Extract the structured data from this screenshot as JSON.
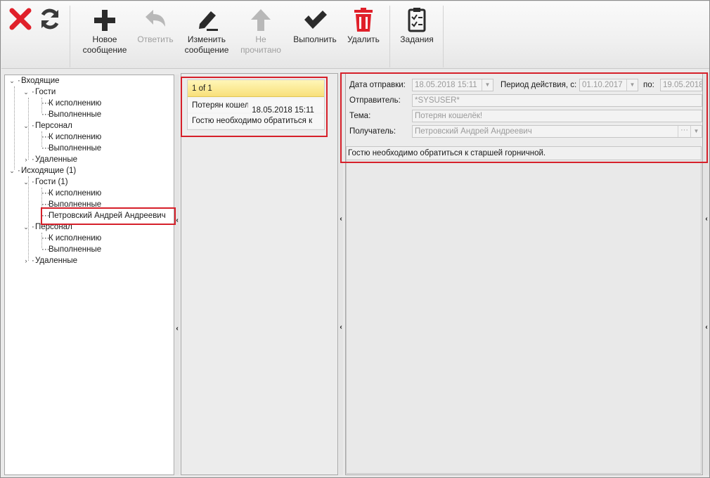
{
  "toolbar": {
    "close_icon": "close-x-icon",
    "refresh_icon": "refresh-icon",
    "buttons": [
      {
        "label1": "Новое",
        "label2": "сообщение",
        "icon": "plus-icon",
        "enabled": true
      },
      {
        "label1": "Ответить",
        "label2": "",
        "icon": "reply-icon",
        "enabled": false
      },
      {
        "label1": "Изменить",
        "label2": "сообщение",
        "icon": "pencil-icon",
        "enabled": true
      },
      {
        "label1": "Не",
        "label2": "прочитано",
        "icon": "arrow-up-icon",
        "enabled": false
      },
      {
        "label1": "Выполнить",
        "label2": "",
        "icon": "check-icon",
        "enabled": true
      },
      {
        "label1": "Удалить",
        "label2": "",
        "icon": "trash-icon",
        "enabled": true
      },
      {
        "label1": "Задания",
        "label2": "",
        "icon": "clipboard-icon",
        "enabled": true
      }
    ]
  },
  "tree": {
    "incoming": "Входящие",
    "incoming_guests": "Гости",
    "incoming_guests_todo": "К исполнению",
    "incoming_guests_done": "Выполненные",
    "incoming_staff": "Персонал",
    "incoming_staff_todo": "К исполнению",
    "incoming_staff_done": "Выполненные",
    "incoming_deleted": "Удаленные",
    "outgoing": "Исходящие (1)",
    "outgoing_guests": "Гости (1)",
    "outgoing_guests_todo": "К исполнению",
    "outgoing_guests_done": "Выполненные",
    "outgoing_guests_person": "Петровский Андрей Андреевич",
    "outgoing_staff": "Персонал",
    "outgoing_staff_todo": "К исполнению",
    "outgoing_staff_done": "Выполненные",
    "outgoing_deleted": "Удаленные"
  },
  "message_list": {
    "pager": "1 of 1",
    "subject": "Потерян кошел",
    "date": "18.05.2018 15:11",
    "preview": "Гостю необходимо обратиться к"
  },
  "detail": {
    "send_date_label": "Дата отправки:",
    "send_date_value": "18.05.2018 15:11",
    "period_label": "Период действия, с:",
    "period_from": "01.10.2017",
    "period_to_label": "по:",
    "period_to": "19.05.2018",
    "sender_label": "Отправитель:",
    "sender_value": "*SYSUSER*",
    "subject_label": "Тема:",
    "subject_value": "Потерян кошелёк!",
    "recipient_label": "Получатель:",
    "recipient_value": "Петровский Андрей Андреевич",
    "body": "Гостю необходимо обратиться к старшей горничной."
  },
  "colors": {
    "highlight_box": "#d6202a",
    "pager_yellow": "#f8e07a"
  }
}
